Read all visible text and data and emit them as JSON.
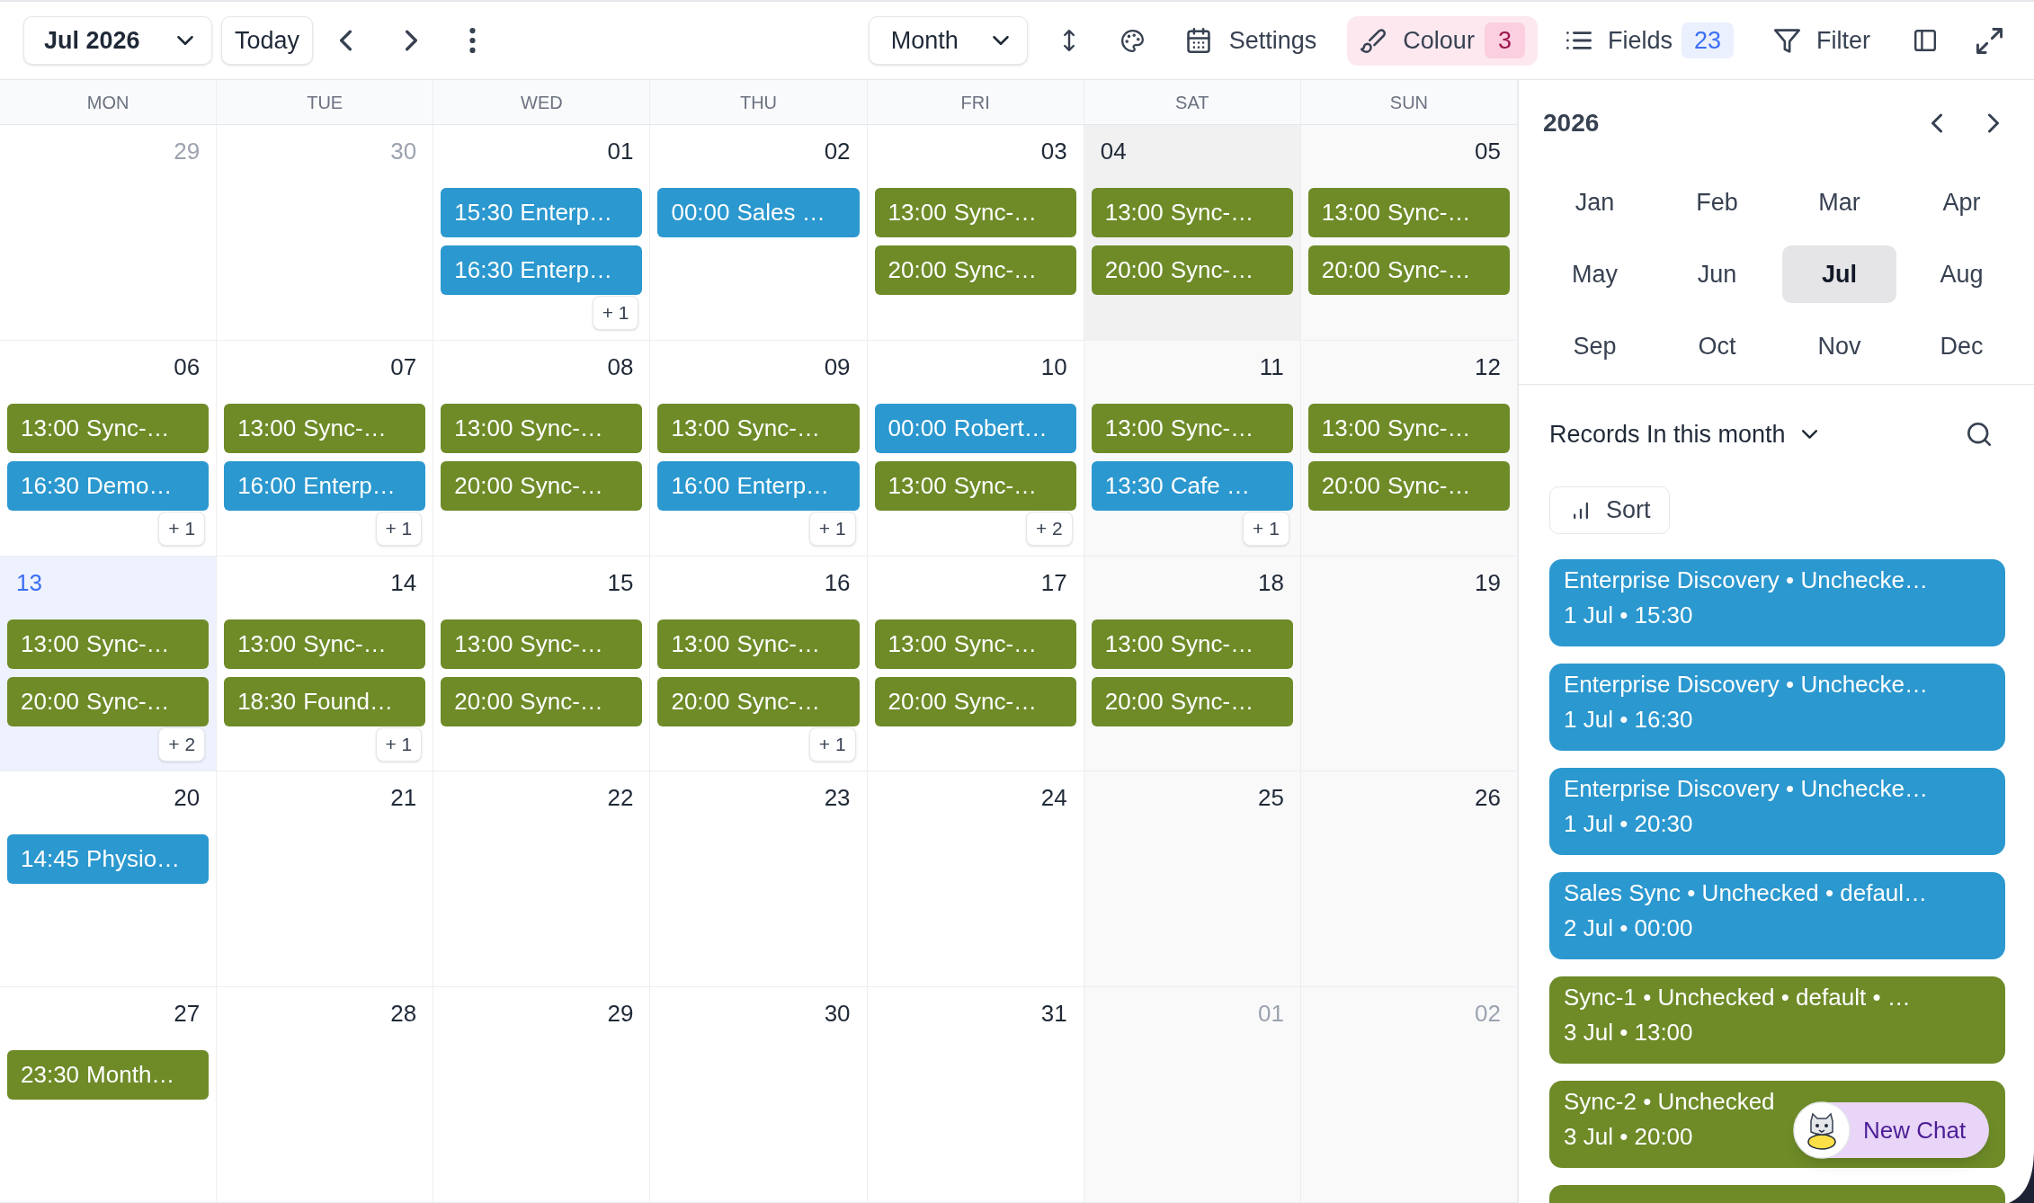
{
  "toolbar": {
    "period": "Jul 2026",
    "today": "Today",
    "view": "Month",
    "settings": "Settings",
    "colour": {
      "label": "Colour",
      "count": "3"
    },
    "fields": {
      "label": "Fields",
      "count": "23"
    },
    "filter": "Filter"
  },
  "calendar": {
    "weekdays": [
      "MON",
      "TUE",
      "WED",
      "THU",
      "FRI",
      "SAT",
      "SUN"
    ],
    "days": [
      {
        "date": "29",
        "outside": true,
        "today": false,
        "selected": false
      },
      {
        "date": "30",
        "outside": true,
        "today": false,
        "selected": false
      },
      {
        "date": "01",
        "outside": false,
        "today": false,
        "selected": false,
        "events": [
          {
            "time": "15:30",
            "title": "Enterp…",
            "color": "#2b98cf"
          },
          {
            "time": "16:30",
            "title": "Enterp…",
            "color": "#2b98cf"
          }
        ],
        "more": "+ 1"
      },
      {
        "date": "02",
        "outside": false,
        "today": false,
        "selected": false,
        "events": [
          {
            "time": "00:00",
            "title": "Sales …",
            "color": "#2b98cf"
          }
        ]
      },
      {
        "date": "03",
        "outside": false,
        "today": false,
        "selected": false,
        "events": [
          {
            "time": "13:00",
            "title": "Sync-…",
            "color": "#6e8b28"
          },
          {
            "time": "20:00",
            "title": "Sync-…",
            "color": "#6e8b28"
          }
        ]
      },
      {
        "date": "04",
        "outside": false,
        "today": false,
        "selected": true,
        "events": [
          {
            "time": "13:00",
            "title": "Sync-…",
            "color": "#6e8b28"
          },
          {
            "time": "20:00",
            "title": "Sync-…",
            "color": "#6e8b28"
          }
        ]
      },
      {
        "date": "05",
        "outside": false,
        "today": false,
        "selected": false,
        "events": [
          {
            "time": "13:00",
            "title": "Sync-…",
            "color": "#6e8b28"
          },
          {
            "time": "20:00",
            "title": "Sync-…",
            "color": "#6e8b28"
          }
        ]
      },
      {
        "date": "06",
        "outside": false,
        "today": false,
        "selected": false,
        "events": [
          {
            "time": "13:00",
            "title": "Sync-…",
            "color": "#6e8b28"
          },
          {
            "time": "16:30",
            "title": "Demo…",
            "color": "#2b98cf"
          }
        ],
        "more": "+ 1"
      },
      {
        "date": "07",
        "outside": false,
        "today": false,
        "selected": false,
        "events": [
          {
            "time": "13:00",
            "title": "Sync-…",
            "color": "#6e8b28"
          },
          {
            "time": "16:00",
            "title": "Enterp…",
            "color": "#2b98cf"
          }
        ],
        "more": "+ 1"
      },
      {
        "date": "08",
        "outside": false,
        "today": false,
        "selected": false,
        "events": [
          {
            "time": "13:00",
            "title": "Sync-…",
            "color": "#6e8b28"
          },
          {
            "time": "20:00",
            "title": "Sync-…",
            "color": "#6e8b28"
          }
        ]
      },
      {
        "date": "09",
        "outside": false,
        "today": false,
        "selected": false,
        "events": [
          {
            "time": "13:00",
            "title": "Sync-…",
            "color": "#6e8b28"
          },
          {
            "time": "16:00",
            "title": "Enterp…",
            "color": "#2b98cf"
          }
        ],
        "more": "+ 1"
      },
      {
        "date": "10",
        "outside": false,
        "today": false,
        "selected": false,
        "events": [
          {
            "time": "00:00",
            "title": "Robert…",
            "color": "#2b98cf"
          },
          {
            "time": "13:00",
            "title": "Sync-…",
            "color": "#6e8b28"
          }
        ],
        "more": "+ 2"
      },
      {
        "date": "11",
        "outside": false,
        "today": false,
        "selected": false,
        "events": [
          {
            "time": "13:00",
            "title": "Sync-…",
            "color": "#6e8b28"
          },
          {
            "time": "13:30",
            "title": "Cafe …",
            "color": "#2b98cf"
          }
        ],
        "more": "+ 1"
      },
      {
        "date": "12",
        "outside": false,
        "today": false,
        "selected": false,
        "events": [
          {
            "time": "13:00",
            "title": "Sync-…",
            "color": "#6e8b28"
          },
          {
            "time": "20:00",
            "title": "Sync-…",
            "color": "#6e8b28"
          }
        ]
      },
      {
        "date": "13",
        "outside": false,
        "today": true,
        "selected": false,
        "events": [
          {
            "time": "13:00",
            "title": "Sync-…",
            "color": "#6e8b28"
          },
          {
            "time": "20:00",
            "title": "Sync-…",
            "color": "#6e8b28"
          }
        ],
        "more": "+ 2"
      },
      {
        "date": "14",
        "outside": false,
        "today": false,
        "selected": false,
        "events": [
          {
            "time": "13:00",
            "title": "Sync-…",
            "color": "#6e8b28"
          },
          {
            "time": "18:30",
            "title": "Found…",
            "color": "#6e8b28"
          }
        ],
        "more": "+ 1"
      },
      {
        "date": "15",
        "outside": false,
        "today": false,
        "selected": false,
        "events": [
          {
            "time": "13:00",
            "title": "Sync-…",
            "color": "#6e8b28"
          },
          {
            "time": "20:00",
            "title": "Sync-…",
            "color": "#6e8b28"
          }
        ]
      },
      {
        "date": "16",
        "outside": false,
        "today": false,
        "selected": false,
        "events": [
          {
            "time": "13:00",
            "title": "Sync-…",
            "color": "#6e8b28"
          },
          {
            "time": "20:00",
            "title": "Sync-…",
            "color": "#6e8b28"
          }
        ],
        "more": "+ 1"
      },
      {
        "date": "17",
        "outside": false,
        "today": false,
        "selected": false,
        "events": [
          {
            "time": "13:00",
            "title": "Sync-…",
            "color": "#6e8b28"
          },
          {
            "time": "20:00",
            "title": "Sync-…",
            "color": "#6e8b28"
          }
        ]
      },
      {
        "date": "18",
        "outside": false,
        "today": false,
        "selected": false,
        "events": [
          {
            "time": "13:00",
            "title": "Sync-…",
            "color": "#6e8b28"
          },
          {
            "time": "20:00",
            "title": "Sync-…",
            "color": "#6e8b28"
          }
        ]
      },
      {
        "date": "19",
        "outside": false,
        "today": false,
        "selected": false
      },
      {
        "date": "20",
        "outside": false,
        "today": false,
        "selected": false,
        "events": [
          {
            "time": "14:45",
            "title": "Physio…",
            "color": "#2b98cf"
          }
        ]
      },
      {
        "date": "21",
        "outside": false,
        "today": false,
        "selected": false
      },
      {
        "date": "22",
        "outside": false,
        "today": false,
        "selected": false
      },
      {
        "date": "23",
        "outside": false,
        "today": false,
        "selected": false
      },
      {
        "date": "24",
        "outside": false,
        "today": false,
        "selected": false
      },
      {
        "date": "25",
        "outside": false,
        "today": false,
        "selected": false
      },
      {
        "date": "26",
        "outside": false,
        "today": false,
        "selected": false
      },
      {
        "date": "27",
        "outside": false,
        "today": false,
        "selected": false,
        "events": [
          {
            "time": "23:30",
            "title": "Month…",
            "color": "#6e8b28"
          }
        ]
      },
      {
        "date": "28",
        "outside": false,
        "today": false,
        "selected": false
      },
      {
        "date": "29",
        "outside": false,
        "today": false,
        "selected": false
      },
      {
        "date": "30",
        "outside": false,
        "today": false,
        "selected": false
      },
      {
        "date": "31",
        "outside": false,
        "today": false,
        "selected": false
      },
      {
        "date": "01",
        "outside": true,
        "today": false,
        "selected": false
      },
      {
        "date": "02",
        "outside": true,
        "today": false,
        "selected": false
      }
    ]
  },
  "side_panel": {
    "year": "2026",
    "months": [
      {
        "label": "Jan",
        "selected": false
      },
      {
        "label": "Feb",
        "selected": false
      },
      {
        "label": "Mar",
        "selected": false
      },
      {
        "label": "Apr",
        "selected": false
      },
      {
        "label": "May",
        "selected": false
      },
      {
        "label": "Jun",
        "selected": false
      },
      {
        "label": "Jul",
        "selected": true
      },
      {
        "label": "Aug",
        "selected": false
      },
      {
        "label": "Sep",
        "selected": false
      },
      {
        "label": "Oct",
        "selected": false
      },
      {
        "label": "Nov",
        "selected": false
      },
      {
        "label": "Dec",
        "selected": false
      }
    ],
    "records_title": "Records In this month",
    "sort": "Sort",
    "records": [
      {
        "title": "Enterprise Discovery • Unchecke…",
        "date": "1 Jul • 15:30",
        "color": "#2b98cf"
      },
      {
        "title": "Enterprise Discovery • Unchecke…",
        "date": "1 Jul • 16:30",
        "color": "#2b98cf"
      },
      {
        "title": "Enterprise Discovery • Unchecke…",
        "date": "1 Jul • 20:30",
        "color": "#2b98cf"
      },
      {
        "title": "Sales Sync • Unchecked • defaul…",
        "date": "2 Jul • 00:00",
        "color": "#2b98cf"
      },
      {
        "title": "Sync-1 • Unchecked • default • …",
        "date": "3 Jul • 13:00",
        "color": "#6e8b28"
      },
      {
        "title": "Sync-2 • Unchecked",
        "date": "3 Jul • 20:00",
        "color": "#6e8b28"
      },
      {
        "color": "#6e8b28"
      }
    ]
  },
  "new_chat": "New Chat"
}
